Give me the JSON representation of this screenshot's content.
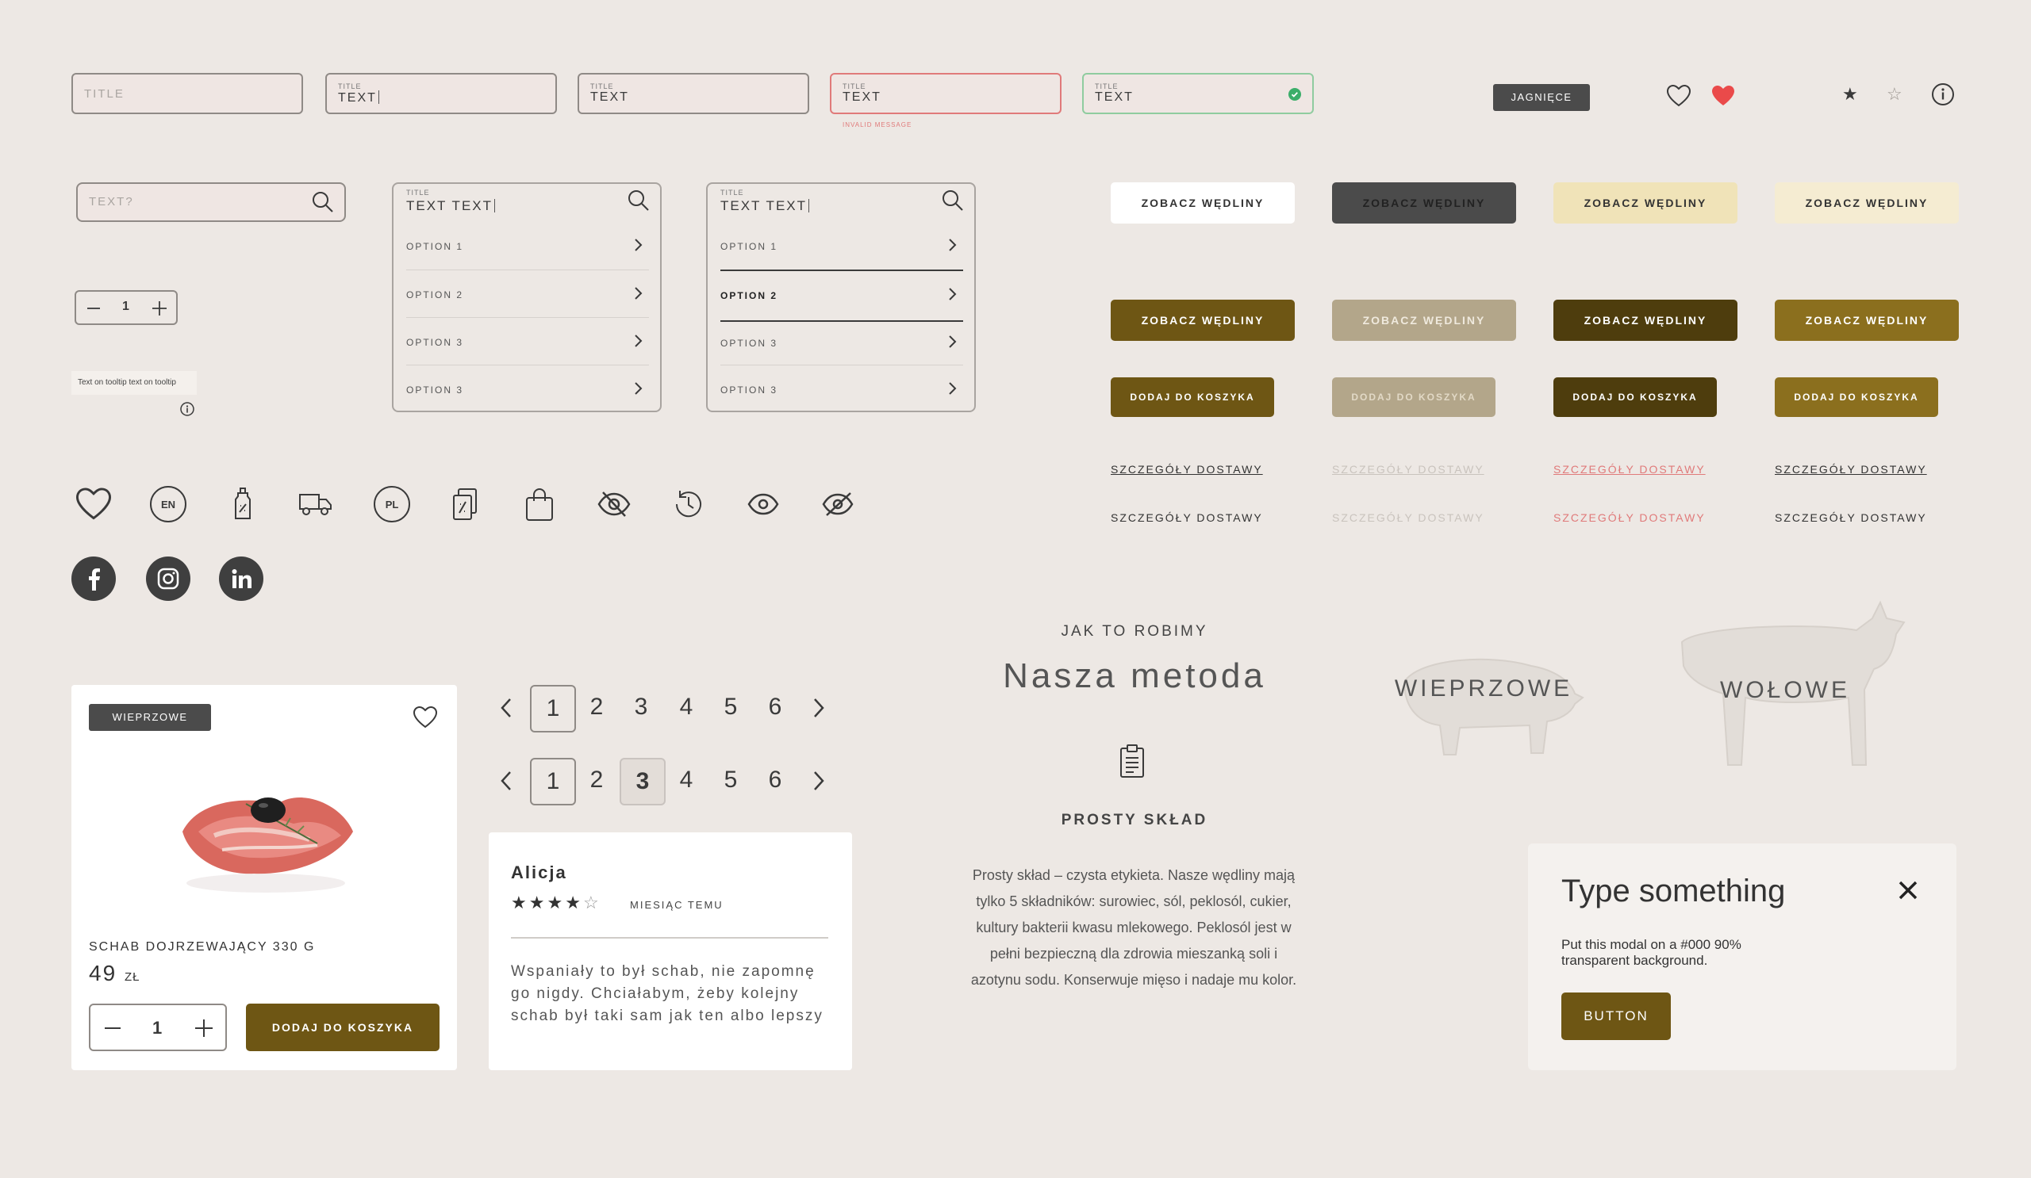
{
  "fields": {
    "title_label": "TITLE",
    "placeholder_title": "TITLE",
    "value": "TEXT",
    "invalid_message": "INVALID MESSAGE"
  },
  "tag_top": "JAGNIĘCE",
  "search": {
    "placeholder": "TEXT?"
  },
  "stepper": {
    "value": "1"
  },
  "tooltip": {
    "text": "Text on tooltip text on tooltip"
  },
  "dropdown1": {
    "title": "TITLE",
    "value": "TEXT TEXT",
    "options": [
      "OPTION 1",
      "OPTION 2",
      "OPTION 3",
      "OPTION 3"
    ]
  },
  "dropdown2": {
    "title": "TITLE",
    "value": "TEXT TEXT",
    "options": [
      "OPTION 1",
      "OPTION 2",
      "OPTION 3",
      "OPTION 3"
    ],
    "active_index": 1
  },
  "buttons": {
    "see_label": "ZOBACZ WĘDLINY",
    "cart_label": "DODAJ DO KOSZYKA",
    "delivery_label": "SZCZEGÓŁY DOSTAWY"
  },
  "icons": {
    "lang_en": "EN",
    "lang_pl": "PL"
  },
  "product": {
    "badge": "WIEPRZOWE",
    "name": "SCHAB DOJRZEWAJĄCY 330 G",
    "price": "49",
    "currency": "ZŁ",
    "qty": "1",
    "cart_button": "DODAJ DO KOSZYKA"
  },
  "pagination": {
    "pages": [
      "1",
      "2",
      "3",
      "4",
      "5",
      "6"
    ]
  },
  "review": {
    "author": "Alicja",
    "rating": 4,
    "time": "MIESIĄC TEMU",
    "text": "Wspaniały to był schab, nie zapomnę go nigdy. Chciałabym, żeby kolejny schab był taki sam jak ten albo lepszy"
  },
  "method": {
    "eyebrow": "JAK TO ROBIMY",
    "title": "Nasza metoda",
    "feature_title": "PROSTY SKŁAD",
    "feature_text": "Prosty skład – czysta etykieta. Nasze wędliny mają tylko 5 składników: surowiec, sól, peklosól, cukier, kultury bakterii kwasu mlekowego. Peklosól jest w pełni bezpieczną dla zdrowia mieszanką soli i azotynu sodu. Konserwuje mięso i nadaje mu kolor."
  },
  "categories": {
    "pork": "WIEPRZOWE",
    "beef": "WOŁOWE"
  },
  "modal": {
    "title": "Type something",
    "text": "Put this modal on a #000 90% transparent background.",
    "button": "BUTTON"
  },
  "colors": {
    "background": "#ede8e4",
    "brown_dark": "#4e3d0d",
    "brown": "#6e5614",
    "gold": "#8b6f1e",
    "taupe": "#b3a68a",
    "cream": "#f0e3b8",
    "invalid": "#e07a7a",
    "valid": "#3cae6a",
    "heart_red": "#ea4a4a"
  }
}
